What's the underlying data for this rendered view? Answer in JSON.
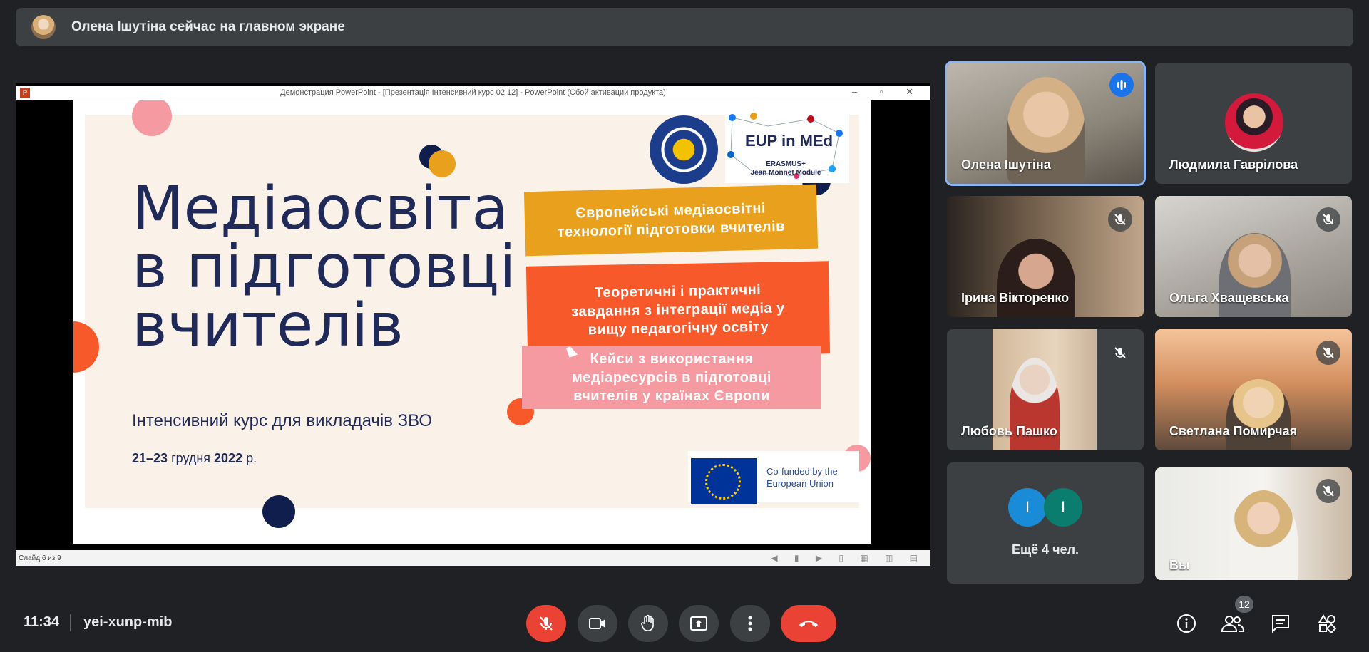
{
  "banner": {
    "text": "Олена Ішутіна сейчас на главном экране"
  },
  "presentation": {
    "window_title": "Демонстрация PowerPoint - [Презентація Інтенсивний курс 02.12] - PowerPoint (Сбой активации продукта)",
    "status_slide": "Слайд 6 из 9",
    "slide": {
      "title_line1": "Медіаосвіта",
      "title_line2": "в підготовці",
      "title_line3": "вчителів",
      "subtitle": "Інтенсивний курс для викладачів ЗВО",
      "dates_bold1": "21–23",
      "dates_mid": " грудня ",
      "dates_bold2": "2022",
      "dates_end": " р.",
      "tag1_l1": "Європейські медіаосвітні",
      "tag1_l2": "технології підготовки вчителів",
      "tag2_l1": "Теоретичні і практичні",
      "tag2_l2": "завдання з інтеграції медіа у",
      "tag2_l3": "вищу педагогічну освіту",
      "tag3_l1": "Кейси з використання",
      "tag3_l2": "медіаресурсів в підготовці",
      "tag3_l3": "вчителів у країнах Європи",
      "eup_title": "EUP in MEd",
      "eup_sub1": "ERASMUS+",
      "eup_sub2": "Jean Monnet Module",
      "cofunded1": "Co-funded by the",
      "cofunded2": "European Union"
    }
  },
  "participants": [
    {
      "name": "Олена Ішутіна",
      "state": "speaking"
    },
    {
      "name": "Людмила Гаврілова",
      "state": "avatar"
    },
    {
      "name": "Ірина Вікторенко",
      "state": "muted"
    },
    {
      "name": "Ольга Хващевська",
      "state": "muted"
    },
    {
      "name": "Любовь Пашко",
      "state": "muted"
    },
    {
      "name": "Светлана Помирчая",
      "state": "muted"
    },
    {
      "name": "Вы",
      "state": "muted"
    }
  ],
  "more_tile": {
    "label": "Ещё 4 чел.",
    "avatar1": "I",
    "avatar2": "I"
  },
  "bottom": {
    "time": "11:34",
    "meeting_code": "yei-xunp-mib",
    "people_count": "12"
  },
  "colors": {
    "accent": "#1a73e8",
    "danger": "#ea4335",
    "slide_navy": "#1f2a58",
    "tag_yellow": "#e9a11d",
    "tag_orange": "#f7592a",
    "tag_pink": "#f69aa1"
  }
}
